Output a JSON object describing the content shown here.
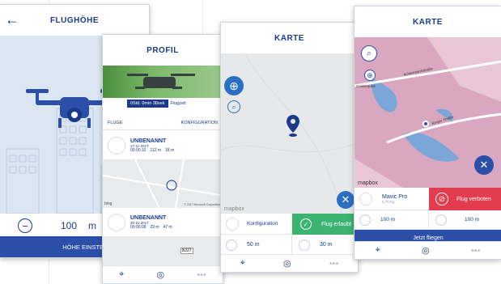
{
  "colors": {
    "accent": "#1b3a8c",
    "blue": "#2b4fa8",
    "sky": "#dbe6f2",
    "green": "#3cb371",
    "red": "#e23c4e"
  },
  "screen1": {
    "title": "FLUGHÖHE",
    "back": "←",
    "value": "100",
    "unit": "m",
    "minus": "−",
    "button": "HÖHE EINSTELLEN"
  },
  "screen2": {
    "title": "PROFIL",
    "time": "0Std. 0min 38sek",
    "time_label": "Flugzeit",
    "tab1": "FLÜGE",
    "tab2": "KONFIGURATION",
    "flights": [
      {
        "name": "UNBENANNT",
        "date": "17-11-2017",
        "duration": "00:00:10",
        "height": "112 m",
        "dist": "18 m"
      },
      {
        "name": "UNBENANNT",
        "date": "30-11-2017",
        "duration": "00:00:08",
        "height": "29 m",
        "dist": "47 m"
      }
    ],
    "map_credit": "© 2017 Microsoft Corporation",
    "bing": "bing",
    "road": "B227"
  },
  "screen3": {
    "title": "KARTE",
    "mapbox": "mapbox",
    "config": "Konfiguration",
    "allowed": "Flug erlaubt",
    "alt": "50 m",
    "radius": "30 m",
    "dots": "•••"
  },
  "screen4": {
    "title": "KARTE",
    "mapbox": "mapbox",
    "drone": "Mavic Pro",
    "weight": "0,75 Kg",
    "forbidden": "Flug verboten",
    "alt": "100 m",
    "radius": "100 m",
    "button": "Jetzt fliegen",
    "dots": "•••",
    "streets": [
      "Achtermannstraße",
      "Ringer Straße",
      "Grabenpark"
    ]
  }
}
